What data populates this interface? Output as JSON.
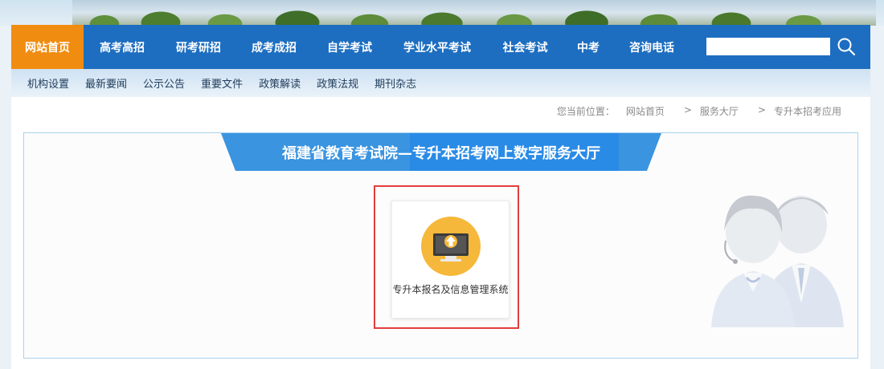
{
  "nav": {
    "items": [
      {
        "label": "网站首页",
        "active": true
      },
      {
        "label": "高考高招"
      },
      {
        "label": "研考研招"
      },
      {
        "label": "成考成招"
      },
      {
        "label": "自学考试"
      },
      {
        "label": "学业水平考试"
      },
      {
        "label": "社会考试"
      },
      {
        "label": "中考"
      },
      {
        "label": "咨询电话"
      }
    ],
    "search": {
      "value": "",
      "placeholder": ""
    }
  },
  "subnav": {
    "items": [
      "机构设置",
      "最新要闻",
      "公示公告",
      "重要文件",
      "政策解读",
      "政策法规",
      "期刊杂志"
    ]
  },
  "breadcrumb": {
    "prefix": "您当前位置：",
    "items": [
      "网站首页",
      "服务大厅",
      "专升本招考应用"
    ],
    "separator": ">"
  },
  "panel": {
    "title": "福建省教育考试院—专升本招考网上数字服务大厅",
    "card": {
      "label": "专升本报名及信息管理系统",
      "icon": "computer-upload-icon"
    }
  },
  "colors": {
    "nav_bg": "#1d6ec0",
    "nav_active": "#f08c10",
    "ribbon": "#3a94e0",
    "highlight": "#e23d3d",
    "icon_bg": "#f6b83a"
  }
}
